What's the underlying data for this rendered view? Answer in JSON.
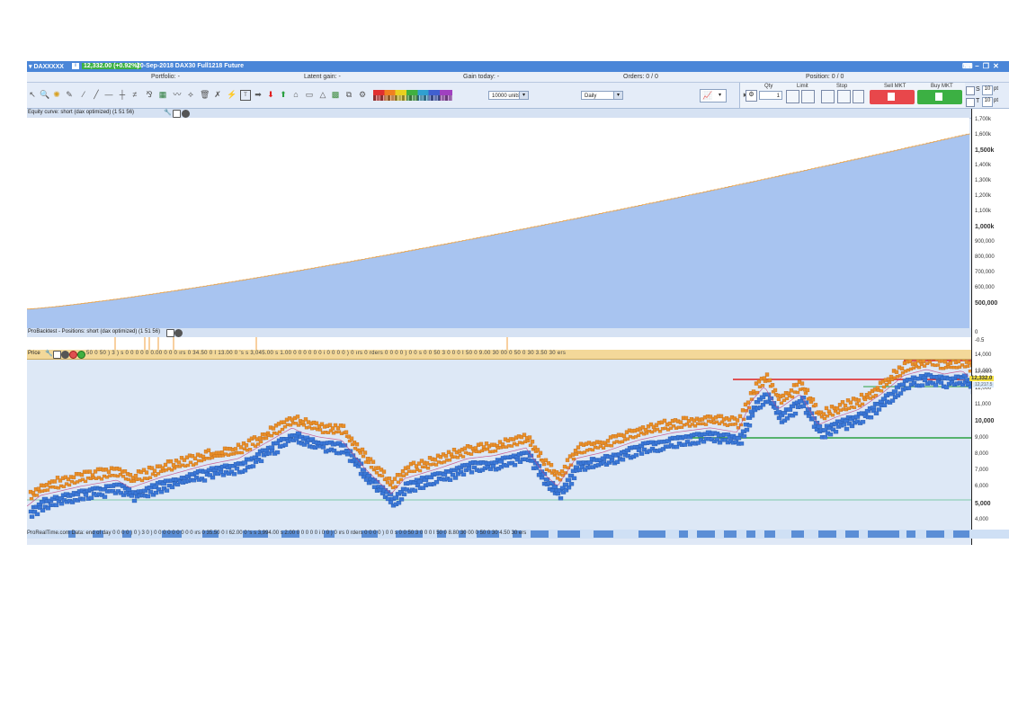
{
  "titlebar": {
    "menu_label": "▾ DAXXXXX",
    "price_chip": "12,332.00 (+0.92%)",
    "description": "20-Sep-2018 DAX30 Full1218 Future"
  },
  "infobar": {
    "portfolio": "Portfolio: -",
    "latent_gain": "Latent gain: -",
    "gain_today": "Gain today: -",
    "orders": "Orders: 0 / 0",
    "position": "Position: 0 / 0"
  },
  "toolbar": {
    "units_select": "10000 units",
    "period_select": "Daily",
    "qty_label": "Qty",
    "qty_value": "1",
    "limit_label": "Limit",
    "stop_label": "Stop",
    "sell_label": "Sell MKT",
    "buy_label": "Buy MKT",
    "s_label": "S",
    "s_value": "10",
    "s_unit": "pt",
    "t_label": "T",
    "t_value": "10",
    "t_unit": "pt"
  },
  "equity_panel": {
    "header": "Equity curve: short (dax optimized) (1 51 56)",
    "axis_labels": [
      "1,700k",
      "1,600k",
      "1,500k",
      "1,400k",
      "1,300k",
      "1,200k",
      "1,100k",
      "1,000k",
      "900,000",
      "800,000",
      "700,000",
      "600,000",
      "500,000"
    ],
    "axis_bold": [
      "1,500k",
      "1,000k",
      "500,000"
    ]
  },
  "positions_panel": {
    "header": "ProBacktest - Positions: short (dax optimized) (1 51 56)",
    "axis_labels": [
      "0",
      "-0.5"
    ]
  },
  "price_panel": {
    "header": "Price",
    "header_numbers": "50   0 50 ) 3 ) s   0 0 0  0 0 0.00   0   0   0 ırs   0   34.50  0 I  13.00  0 's s 3,045.00 s 1.00  0  0 0 0  0 0 i  0  0 0  0 ) 0 ırs  0  rders  0  0 0  0 ) 0  0 s 0  0 50 3 0  0  0 I 50 0 9.00 30 00  0  50  0  30 3.50  30  ers",
    "axis_labels": [
      "14,000",
      "13,000",
      "12,000",
      "11,000",
      "10,000",
      "9,000",
      "8,000",
      "7,000",
      "6,000",
      "5,000",
      "4,000"
    ],
    "axis_bold": [
      "10,000",
      "5,000"
    ],
    "price_marker": "12,332.0",
    "small_markers": [
      "12,456.0",
      "12,217.5"
    ],
    "bottom_numbers": "ProRealTime.com  Data: end of day   0  0 0  0 ) 0 ) 3  0 ) 0 0  0  0 0  0 0  0   0 ırs   0   35.50  0 I  62.00  0 's s 3,994.00 s 2.00  0  0 0 0  0  i  0  0 ) 0 ırs  0  rders  0  0 0  0 ) 0  0 s 0  0 50 3 0  0  0 I 50 0 8.80 30 00  0  50  0  30 4.50  30  ers"
  },
  "colors": {
    "titlebar": "#4a86d8",
    "equity_fill": "#a8c4f0",
    "equity_line": "#e8a24a",
    "price_bg": "#dde8f6",
    "candles_up": "#e8902a",
    "candles_down": "#3b78d8",
    "resistance": "#e02020",
    "support": "#2aa040"
  }
}
